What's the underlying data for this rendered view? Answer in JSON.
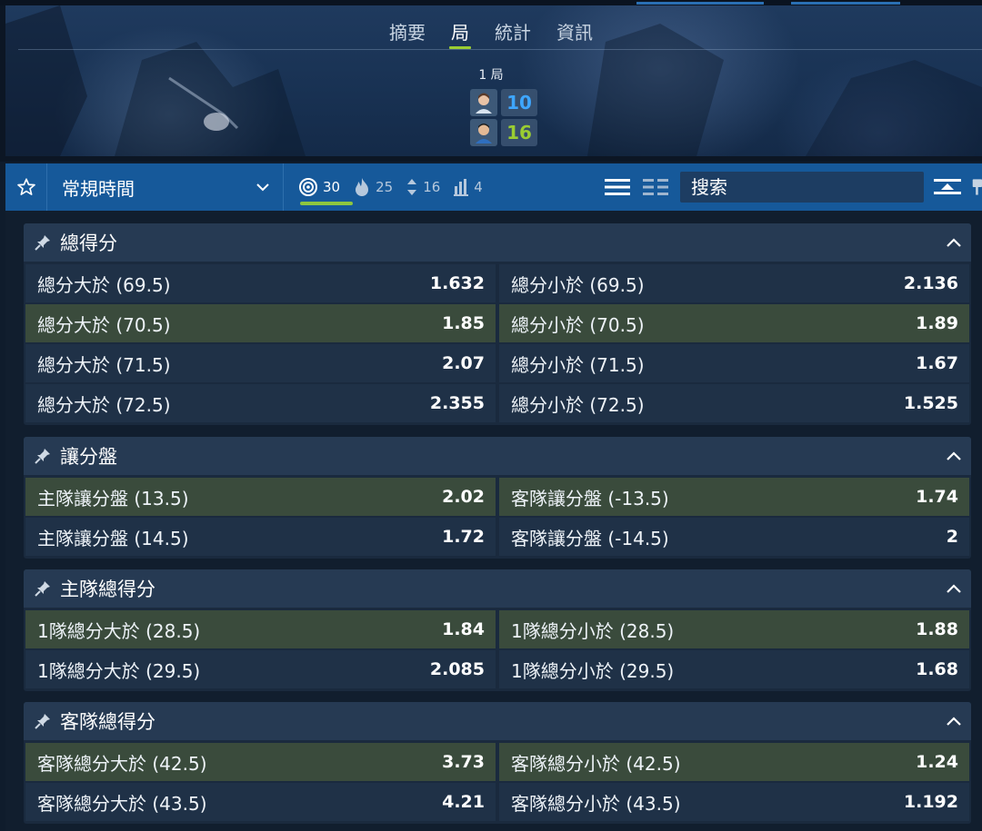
{
  "header": {
    "tabs": [
      {
        "label": "摘要",
        "active": false
      },
      {
        "label": "局",
        "active": true
      },
      {
        "label": "統計",
        "active": false
      },
      {
        "label": "資訊",
        "active": false
      }
    ],
    "period": "1 局",
    "home_score": "10",
    "away_score": "16",
    "home_score_color": "#3ea6ff",
    "away_score_color": "#9acd32"
  },
  "toolbar": {
    "period_select": "常規時間",
    "stats": [
      {
        "icon": "target-icon",
        "count": "30"
      },
      {
        "icon": "fire-icon",
        "count": "25"
      },
      {
        "icon": "up-down-icon",
        "count": "16"
      },
      {
        "icon": "bars-icon",
        "count": "4"
      }
    ],
    "search_placeholder": "搜索"
  },
  "markets": [
    {
      "title": "總得分",
      "rows": [
        {
          "left": {
            "label": "總分大於 (69.5)",
            "odds": "1.632",
            "highlight": false
          },
          "right": {
            "label": "總分小於 (69.5)",
            "odds": "2.136",
            "highlight": false
          }
        },
        {
          "left": {
            "label": "總分大於 (70.5)",
            "odds": "1.85",
            "highlight": true
          },
          "right": {
            "label": "總分小於 (70.5)",
            "odds": "1.89",
            "highlight": true
          }
        },
        {
          "left": {
            "label": "總分大於 (71.5)",
            "odds": "2.07",
            "highlight": false
          },
          "right": {
            "label": "總分小於 (71.5)",
            "odds": "1.67",
            "highlight": false
          }
        },
        {
          "left": {
            "label": "總分大於 (72.5)",
            "odds": "2.355",
            "highlight": false
          },
          "right": {
            "label": "總分小於 (72.5)",
            "odds": "1.525",
            "highlight": false
          }
        }
      ]
    },
    {
      "title": "讓分盤",
      "rows": [
        {
          "left": {
            "label": "主隊讓分盤 (13.5)",
            "odds": "2.02",
            "highlight": true
          },
          "right": {
            "label": "客隊讓分盤 (-13.5)",
            "odds": "1.74",
            "highlight": true
          }
        },
        {
          "left": {
            "label": "主隊讓分盤 (14.5)",
            "odds": "1.72",
            "highlight": false
          },
          "right": {
            "label": "客隊讓分盤 (-14.5)",
            "odds": "2",
            "highlight": false
          }
        }
      ]
    },
    {
      "title": "主隊總得分",
      "rows": [
        {
          "left": {
            "label": "1隊總分大於 (28.5)",
            "odds": "1.84",
            "highlight": true
          },
          "right": {
            "label": "1隊總分小於 (28.5)",
            "odds": "1.88",
            "highlight": true
          }
        },
        {
          "left": {
            "label": "1隊總分大於 (29.5)",
            "odds": "2.085",
            "highlight": false
          },
          "right": {
            "label": "1隊總分小於 (29.5)",
            "odds": "1.68",
            "highlight": false
          }
        }
      ]
    },
    {
      "title": "客隊總得分",
      "rows": [
        {
          "left": {
            "label": "客隊總分大於 (42.5)",
            "odds": "3.73",
            "highlight": true
          },
          "right": {
            "label": "客隊總分小於 (42.5)",
            "odds": "1.24",
            "highlight": true
          }
        },
        {
          "left": {
            "label": "客隊總分大於 (43.5)",
            "odds": "4.21",
            "highlight": false
          },
          "right": {
            "label": "客隊總分小於 (43.5)",
            "odds": "1.192",
            "highlight": false
          }
        }
      ]
    }
  ]
}
